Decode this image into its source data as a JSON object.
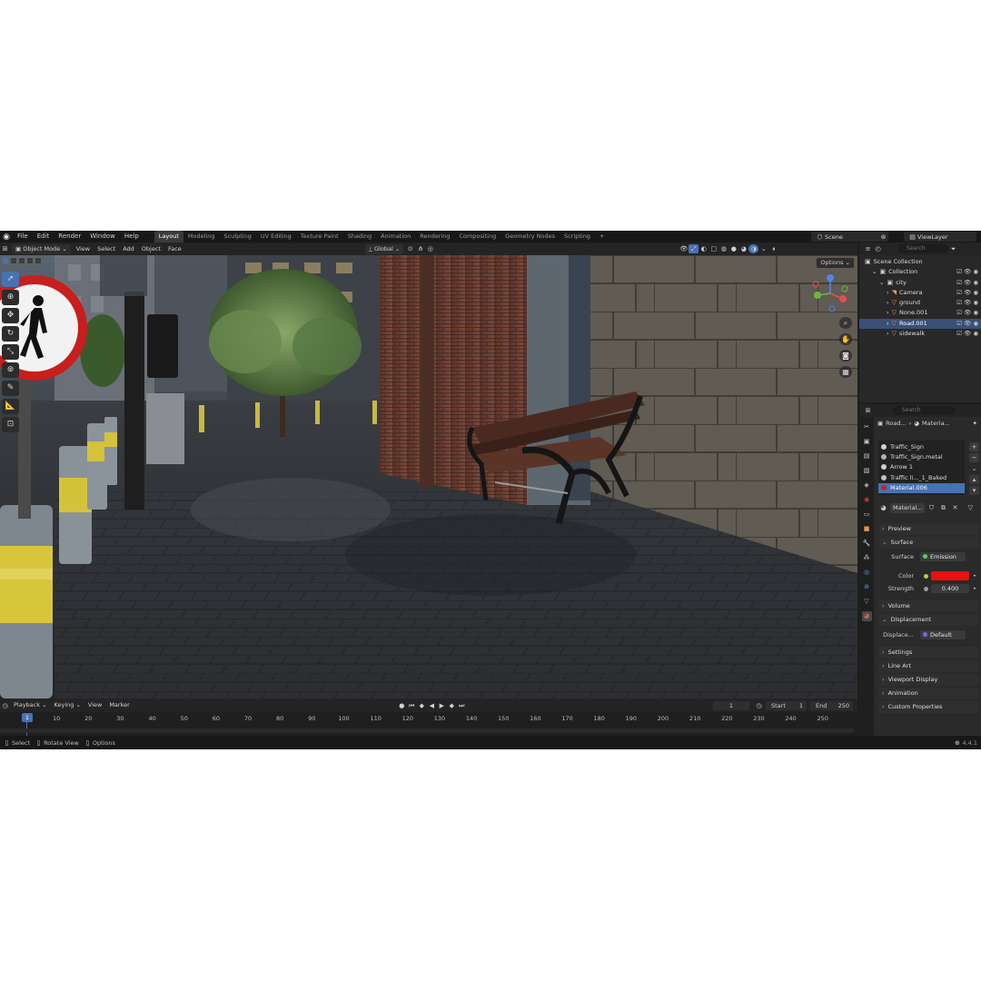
{
  "topbar": {
    "menus": [
      "File",
      "Edit",
      "Render",
      "Window",
      "Help"
    ],
    "workspaces": [
      "Layout",
      "Modeling",
      "Sculpting",
      "UV Editing",
      "Texture Paint",
      "Shading",
      "Animation",
      "Rendering",
      "Compositing",
      "Geometry Nodes",
      "Scripting"
    ],
    "active_workspace": "Layout",
    "add_tab": "+",
    "scene": "Scene",
    "view_layer": "ViewLayer"
  },
  "viewport_header": {
    "mode": "Object Mode",
    "menus": [
      "View",
      "Select",
      "Add",
      "Object",
      "Face"
    ],
    "orientation": "Global",
    "options_label": "Options"
  },
  "viewport": {
    "accent": "#4772b3"
  },
  "outliner": {
    "search_placeholder": "Search",
    "rows": [
      {
        "label": "Scene Collection",
        "indent": 0
      },
      {
        "label": "Collection",
        "indent": 1
      },
      {
        "label": "city",
        "indent": 2
      },
      {
        "label": "Camera",
        "indent": 3
      },
      {
        "label": "ground",
        "indent": 3
      },
      {
        "label": "None.001",
        "indent": 3
      },
      {
        "label": "Road.001",
        "indent": 3,
        "selected": true
      },
      {
        "label": "sidewalk",
        "indent": 3
      }
    ]
  },
  "properties": {
    "search_placeholder": "Search",
    "breadcrumb_object": "Road...",
    "breadcrumb_material": "Materia...",
    "materials": [
      {
        "label": "Traffic_Sign",
        "color": "#d8d0c0"
      },
      {
        "label": "Traffic_Sign.metal",
        "color": "#b0b0b0"
      },
      {
        "label": "Arrow 1",
        "color": "#cfcfcf"
      },
      {
        "label": "Traffic li..._1_Baked",
        "color": "#c0c0c0"
      },
      {
        "label": "Material.006",
        "color": "#d42020",
        "selected": true
      }
    ],
    "material_slot": "Material...",
    "panels": {
      "preview": "Preview",
      "surface": "Surface",
      "volume": "Volume",
      "displacement": "Displacement",
      "settings": "Settings",
      "line_art": "Line Art",
      "viewport_display": "Viewport Display",
      "animation": "Animation",
      "custom_properties": "Custom Properties"
    },
    "surface_label": "Surface",
    "surface_value": "Emission",
    "color_label": "Color",
    "color_value": "#e81010",
    "strength_label": "Strength",
    "strength_value": "0.400",
    "displacement_label": "Displace...",
    "displacement_value": "Default"
  },
  "timeline": {
    "menus": [
      "Playback",
      "Keying",
      "View",
      "Marker"
    ],
    "current_frame": "1",
    "start_label": "Start",
    "start_value": "1",
    "end_label": "End",
    "end_value": "250",
    "ticks": [
      "10",
      "20",
      "30",
      "40",
      "50",
      "60",
      "70",
      "80",
      "90",
      "100",
      "110",
      "120",
      "130",
      "140",
      "150",
      "160",
      "170",
      "180",
      "190",
      "200",
      "210",
      "220",
      "230",
      "240",
      "250"
    ],
    "marker": "1"
  },
  "statusbar": {
    "select": "Select",
    "rotate": "Rotate View",
    "options": "Options",
    "version": "4.4.1"
  }
}
